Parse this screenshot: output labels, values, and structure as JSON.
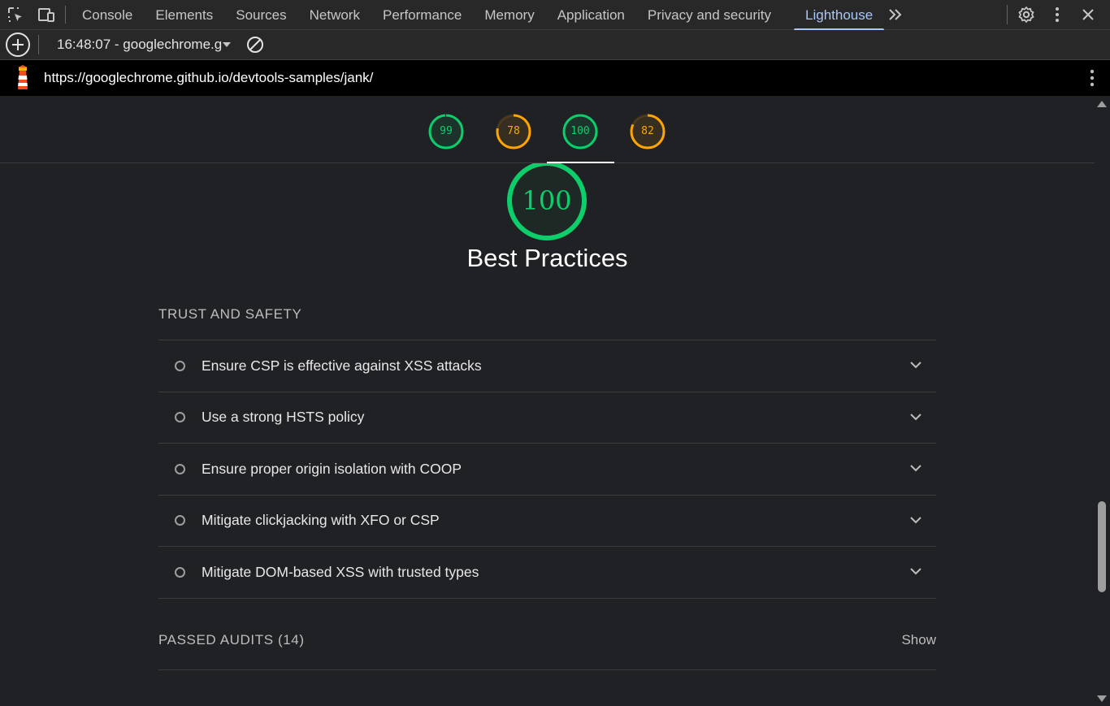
{
  "devtools": {
    "tabs": [
      {
        "label": "Console"
      },
      {
        "label": "Elements"
      },
      {
        "label": "Sources"
      },
      {
        "label": "Network"
      },
      {
        "label": "Performance"
      },
      {
        "label": "Memory"
      },
      {
        "label": "Application"
      },
      {
        "label": "Privacy and security"
      },
      {
        "label": "Lighthouse",
        "active": true
      }
    ],
    "icons": [
      "inspect-element-icon",
      "device-toolbar-icon",
      "more-tabs-icon",
      "settings-icon",
      "kebab-menu-icon",
      "close-icon"
    ]
  },
  "toolbar": {
    "report_label": "16:48:07 - googlechrome.g",
    "icons": [
      "new-report-icon",
      "clear-icon"
    ]
  },
  "urlbar": {
    "url": "https://googlechrome.github.io/devtools-samples/jank/"
  },
  "scores": [
    {
      "value": "99",
      "color": "#0cce6b",
      "fraction": 0.99
    },
    {
      "value": "78",
      "color": "#ffa400",
      "fraction": 0.78
    },
    {
      "value": "100",
      "color": "#0cce6b",
      "fraction": 1.0,
      "selected": true
    },
    {
      "value": "82",
      "color": "#ffa400",
      "fraction": 0.82
    }
  ],
  "category": {
    "score": "100",
    "title": "Best Practices"
  },
  "group": {
    "title": "TRUST AND SAFETY",
    "audits": [
      {
        "title": "Ensure CSP is effective against XSS attacks"
      },
      {
        "title": "Use a strong HSTS policy"
      },
      {
        "title": "Ensure proper origin isolation with COOP"
      },
      {
        "title": "Mitigate clickjacking with XFO or CSP"
      },
      {
        "title": "Mitigate DOM-based XSS with trusted types"
      }
    ]
  },
  "passed": {
    "label": "PASSED AUDITS (14)",
    "toggle": "Show"
  }
}
